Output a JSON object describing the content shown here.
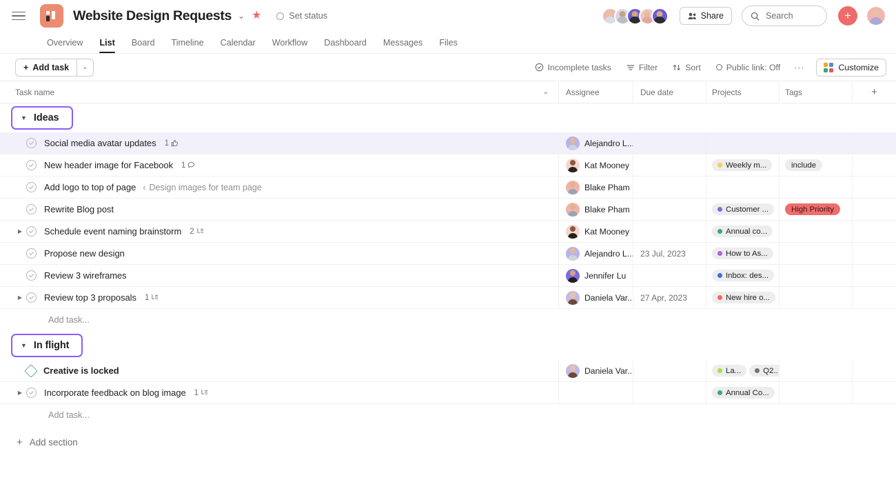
{
  "header": {
    "menu_icon": "hamburger-icon",
    "project_icon": "project-board-icon",
    "title": "Website Design Requests",
    "title_caret": "⌄",
    "star_icon": "★",
    "status_label": "Set status",
    "share_label": "Share",
    "search_placeholder": "Search",
    "plus_label": "+",
    "accent_color": "#f06a6a",
    "members": [
      {
        "name": "member-1",
        "ring": "#f3b6ae",
        "head": "#e8c0a8",
        "body": "#d9dde4"
      },
      {
        "name": "member-2",
        "ring": "#d8d8e8",
        "head": "#c9a183",
        "body": "#b9bcc4"
      },
      {
        "name": "member-3",
        "ring": "#6a5bd4",
        "head": "#d0a383",
        "body": "#2b2b33"
      },
      {
        "name": "member-4",
        "ring": "#f0c7c0",
        "head": "#e5bba0",
        "body": "#e0a9a0"
      },
      {
        "name": "member-5",
        "ring": "#6a5bd4",
        "head": "#d6aa88",
        "body": "#2b2b33"
      }
    ],
    "me_avatar": {
      "ring": "#f3b6ae",
      "head": "#e8c0a8",
      "body": "#a9a8d6"
    }
  },
  "tabs": [
    {
      "label": "Overview",
      "active": false
    },
    {
      "label": "List",
      "active": true
    },
    {
      "label": "Board",
      "active": false
    },
    {
      "label": "Timeline",
      "active": false
    },
    {
      "label": "Calendar",
      "active": false
    },
    {
      "label": "Workflow",
      "active": false
    },
    {
      "label": "Dashboard",
      "active": false
    },
    {
      "label": "Messages",
      "active": false
    },
    {
      "label": "Files",
      "active": false
    }
  ],
  "toolbar": {
    "add_task_label": "Add task",
    "add_task_caret": "⌄",
    "incomplete_label": "Incomplete tasks",
    "filter_label": "Filter",
    "sort_label": "Sort",
    "public_link_label": "Public link: Off",
    "more_label": "···",
    "customize_label": "Customize"
  },
  "columns": {
    "task_name": "Task name",
    "assignee": "Assignee",
    "due_date": "Due date",
    "projects": "Projects",
    "tags": "Tags",
    "add_column": "+"
  },
  "sections": [
    {
      "name": "Ideas",
      "collapsed": false,
      "add_task_placeholder": "Add task...",
      "tasks": [
        {
          "name": "Social media avatar updates",
          "bold": false,
          "milestone": false,
          "expandable": false,
          "selected": true,
          "parent_ref": "",
          "meta_count": "1",
          "meta_icon": "thumbs-up-icon",
          "assignee": "Alejandro L...",
          "assignee_avatar": {
            "ring": "#b9b3e8",
            "head": "#e0bb9c",
            "body": "#cfd4dc"
          },
          "due": "",
          "projects": [],
          "tags": []
        },
        {
          "name": "New header image for Facebook",
          "bold": false,
          "milestone": false,
          "expandable": false,
          "selected": false,
          "parent_ref": "",
          "meta_count": "1",
          "meta_icon": "comment-icon",
          "assignee": "Kat Mooney",
          "assignee_avatar": {
            "ring": "#f6d5d0",
            "head": "#8a5a3c",
            "body": "#2b2118"
          },
          "due": "",
          "projects": [
            {
              "label": "Weekly m...",
              "color": "#f1d04f"
            }
          ],
          "tags": [
            {
              "label": "include",
              "bg": "#ededed",
              "fg": "#1e1f21"
            }
          ]
        },
        {
          "name": "Add logo to top of page",
          "bold": false,
          "milestone": false,
          "expandable": false,
          "selected": false,
          "parent_ref": "Design images for team page",
          "meta_count": "",
          "meta_icon": "",
          "assignee": "Blake Pham",
          "assignee_avatar": {
            "ring": "#f0b3ab",
            "head": "#e3b18f",
            "body": "#9aa3b4"
          },
          "due": "",
          "projects": [],
          "tags": []
        },
        {
          "name": "Rewrite Blog post",
          "bold": false,
          "milestone": false,
          "expandable": false,
          "selected": false,
          "parent_ref": "",
          "meta_count": "",
          "meta_icon": "",
          "assignee": "Blake Pham",
          "assignee_avatar": {
            "ring": "#f0b3ab",
            "head": "#e3b18f",
            "body": "#9aa3b4"
          },
          "due": "",
          "projects": [
            {
              "label": "Customer ...",
              "color": "#7b68ee"
            }
          ],
          "tags": [
            {
              "label": "High Priority",
              "bg": "#ef6d6d",
              "fg": "#3b1414"
            }
          ]
        },
        {
          "name": "Schedule event naming brainstorm",
          "bold": false,
          "milestone": false,
          "expandable": true,
          "selected": false,
          "parent_ref": "",
          "meta_count": "2",
          "meta_icon": "subtask-icon",
          "assignee": "Kat Mooney",
          "assignee_avatar": {
            "ring": "#f6d5d0",
            "head": "#8a5a3c",
            "body": "#2b2118"
          },
          "due": "",
          "projects": [
            {
              "label": "Annual co...",
              "color": "#3ba776"
            }
          ],
          "tags": []
        },
        {
          "name": "Propose new design",
          "bold": false,
          "milestone": false,
          "expandable": false,
          "selected": false,
          "parent_ref": "",
          "meta_count": "",
          "meta_icon": "",
          "assignee": "Alejandro L...",
          "assignee_avatar": {
            "ring": "#b9b3e8",
            "head": "#e0bb9c",
            "body": "#cfd4dc"
          },
          "due": "23 Jul, 2023",
          "projects": [
            {
              "label": "How to As...",
              "color": "#b45ee0"
            }
          ],
          "tags": []
        },
        {
          "name": "Review 3 wireframes",
          "bold": false,
          "milestone": false,
          "expandable": false,
          "selected": false,
          "parent_ref": "",
          "meta_count": "",
          "meta_icon": "",
          "assignee": "Jennifer Lu",
          "assignee_avatar": {
            "ring": "#7a6be0",
            "head": "#d6a483",
            "body": "#241f1a"
          },
          "due": "",
          "projects": [
            {
              "label": "Inbox: des...",
              "color": "#3b6fe0"
            }
          ],
          "tags": []
        },
        {
          "name": "Review top 3 proposals",
          "bold": false,
          "milestone": false,
          "expandable": true,
          "selected": false,
          "parent_ref": "",
          "meta_count": "1",
          "meta_icon": "subtask-icon",
          "assignee": "Daniela Var...",
          "assignee_avatar": {
            "ring": "#c3b9e8",
            "head": "#e8c3a4",
            "body": "#6b4a34"
          },
          "due": "27 Apr, 2023",
          "projects": [
            {
              "label": "New hire o...",
              "color": "#f0685f"
            }
          ],
          "tags": []
        }
      ]
    },
    {
      "name": "In flight",
      "collapsed": false,
      "add_task_placeholder": "Add task...",
      "tasks": [
        {
          "name": "Creative is locked",
          "bold": true,
          "milestone": true,
          "expandable": false,
          "selected": false,
          "parent_ref": "",
          "meta_count": "",
          "meta_icon": "",
          "assignee": "Daniela Var...",
          "assignee_avatar": {
            "ring": "#c3b9e8",
            "head": "#e8c3a4",
            "body": "#6b4a34"
          },
          "due": "",
          "projects": [
            {
              "label": "La...",
              "color": "#a9dc4a"
            },
            {
              "label": "Q2..",
              "color": "#6f7378"
            }
          ],
          "tags": []
        },
        {
          "name": "Incorporate feedback on blog image",
          "bold": false,
          "milestone": false,
          "expandable": true,
          "selected": false,
          "parent_ref": "",
          "meta_count": "1",
          "meta_icon": "subtask-icon",
          "assignee": "",
          "assignee_avatar": null,
          "due": "",
          "projects": [
            {
              "label": "Annual Co...",
              "color": "#3ba776"
            }
          ],
          "tags": []
        }
      ]
    }
  ],
  "footer": {
    "add_section_label": "Add section",
    "add_section_plus": "+"
  }
}
